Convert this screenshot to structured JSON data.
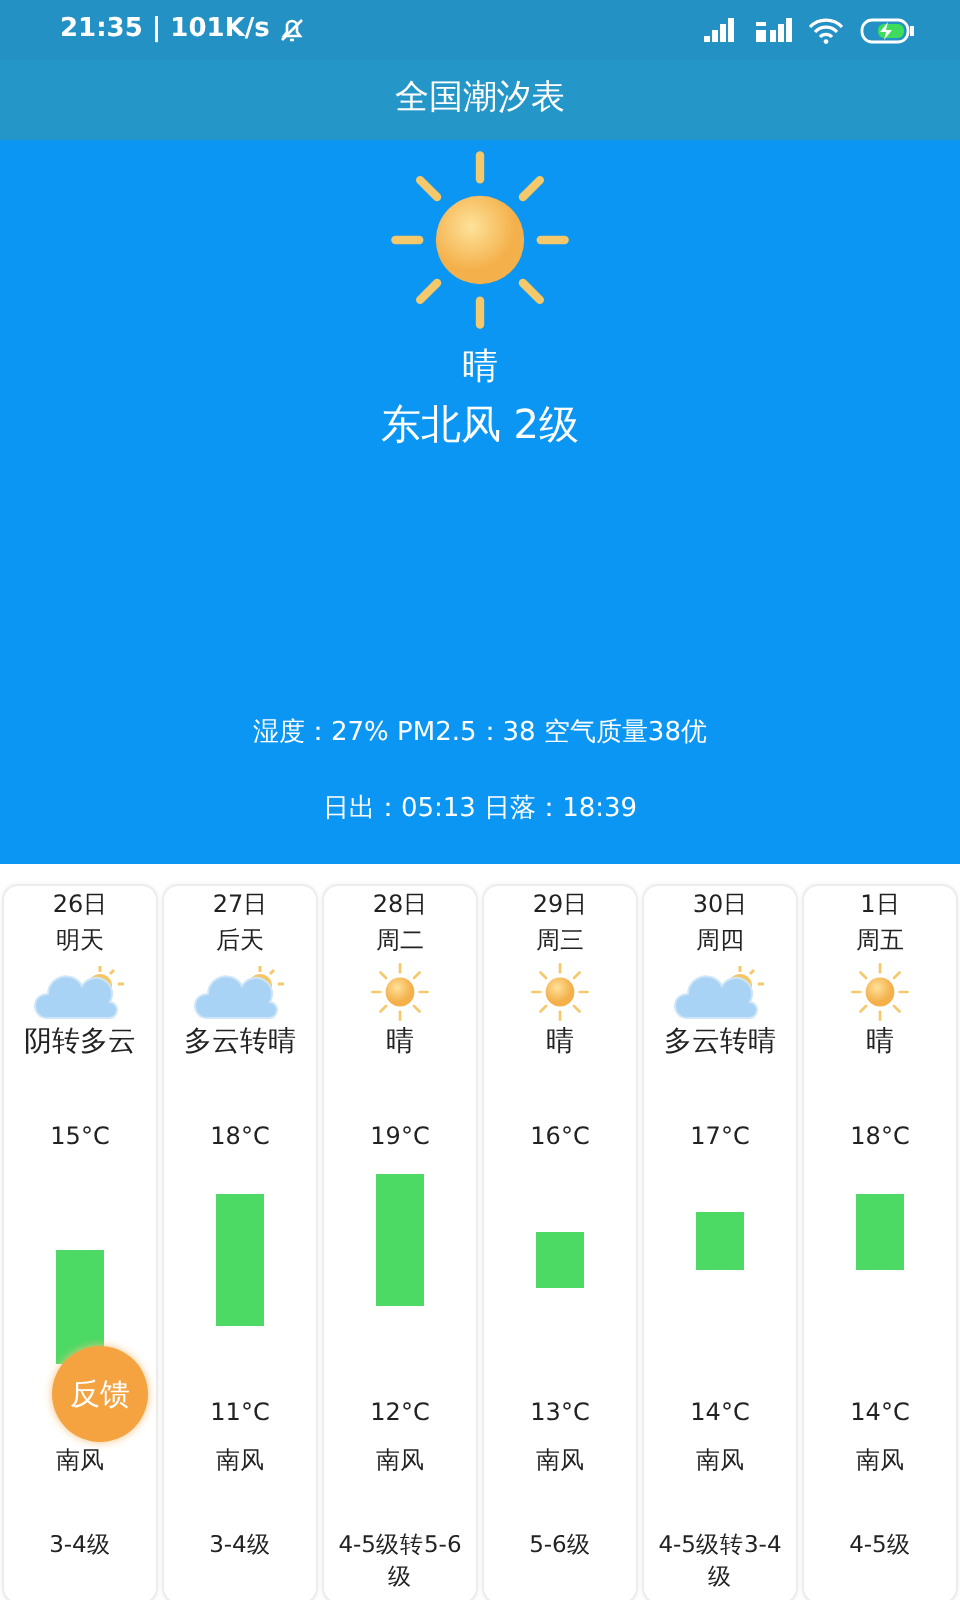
{
  "status_bar": {
    "time": "21:35 | 101K/s"
  },
  "title": "全国潮汐表",
  "current": {
    "kind": "sunny",
    "weather": "晴",
    "wind": "东北风 2级",
    "air": "湿度：27% PM2.5：38 空气质量38优",
    "sun": "日出：05:13 日落：18:39"
  },
  "days": [
    {
      "date": "26日",
      "day": "明天",
      "kind": "cloudy",
      "weather": "阴转多云",
      "high": "15°C",
      "wind": "南风",
      "level_text": "3-4级"
    },
    {
      "date": "27日",
      "day": "后天",
      "kind": "cloudy",
      "weather": "多云转晴",
      "high": "18°C",
      "low": "11°C",
      "wind": "南风",
      "level_text": "3-4级"
    },
    {
      "date": "28日",
      "day": "周二",
      "kind": "sunny",
      "weather": "晴",
      "high": "19°C",
      "low": "12°C",
      "wind": "南风",
      "level_text": "4-5级转5-6级"
    },
    {
      "date": "29日",
      "day": "周三",
      "kind": "sunny",
      "weather": "晴",
      "high": "16°C",
      "low": "13°C",
      "wind": "南风",
      "level_text": "5-6级"
    },
    {
      "date": "30日",
      "day": "周四",
      "kind": "cloudy",
      "weather": "多云转晴",
      "high": "17°C",
      "low": "14°C",
      "wind": "南风",
      "level_text": "4-5级转3-4级"
    },
    {
      "date": "1日",
      "day": "周五",
      "kind": "sunny",
      "weather": "晴",
      "high": "18°C",
      "low": "14°C",
      "wind": "南风",
      "level_text": "4-5级"
    }
  ],
  "feedback": "反馈"
}
